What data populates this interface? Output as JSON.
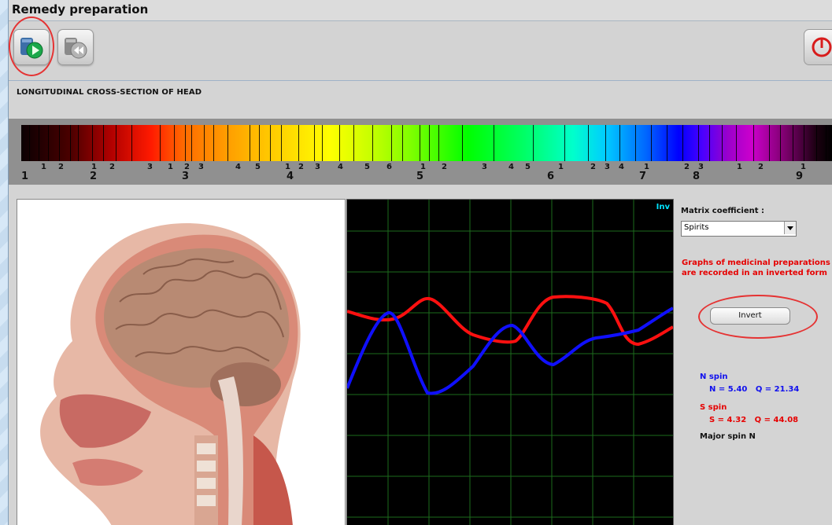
{
  "window": {
    "title": "Remedy preparation"
  },
  "toolbar": {
    "buttons": [
      {
        "icon": "play-disc-icon"
      },
      {
        "icon": "rewind-disc-icon"
      },
      {
        "icon": "power-icon"
      }
    ]
  },
  "section": {
    "label": "LONGITUDINAL CROSS-SECTION OF HEAD"
  },
  "spectrum": {
    "big_labels": [
      "1",
      "2",
      "3",
      "4",
      "5",
      "6",
      "7",
      "8",
      "9"
    ],
    "small_labels": [
      "1",
      "2",
      "1",
      "2",
      "3",
      "1",
      "2",
      "3",
      "4",
      "5",
      "1",
      "2",
      "3",
      "4",
      "5",
      "6",
      "1",
      "2",
      "3",
      "4",
      "5",
      "1",
      "2",
      "3",
      "4",
      "1",
      "2",
      "3",
      "1",
      "2",
      "1"
    ]
  },
  "graph": {
    "corner_label": "Inv",
    "colors": {
      "n_spin": "#1010ff",
      "s_spin": "#ff1010",
      "grid": "#1d6b1d"
    }
  },
  "side": {
    "matrix_label": "Matrix coefficient :",
    "matrix_value": "Spirits",
    "warning_line1": "Graphs of medicinal preparations",
    "warning_line2": "are recorded in an inverted form",
    "invert_label": "Invert",
    "n_spin_title": "N spin",
    "n_spin_values": "N = 5.40   Q = 21.34",
    "s_spin_title": "S spin",
    "s_spin_values": "S = 4.32   Q = 44.08",
    "major_spin": "Major spin N"
  }
}
